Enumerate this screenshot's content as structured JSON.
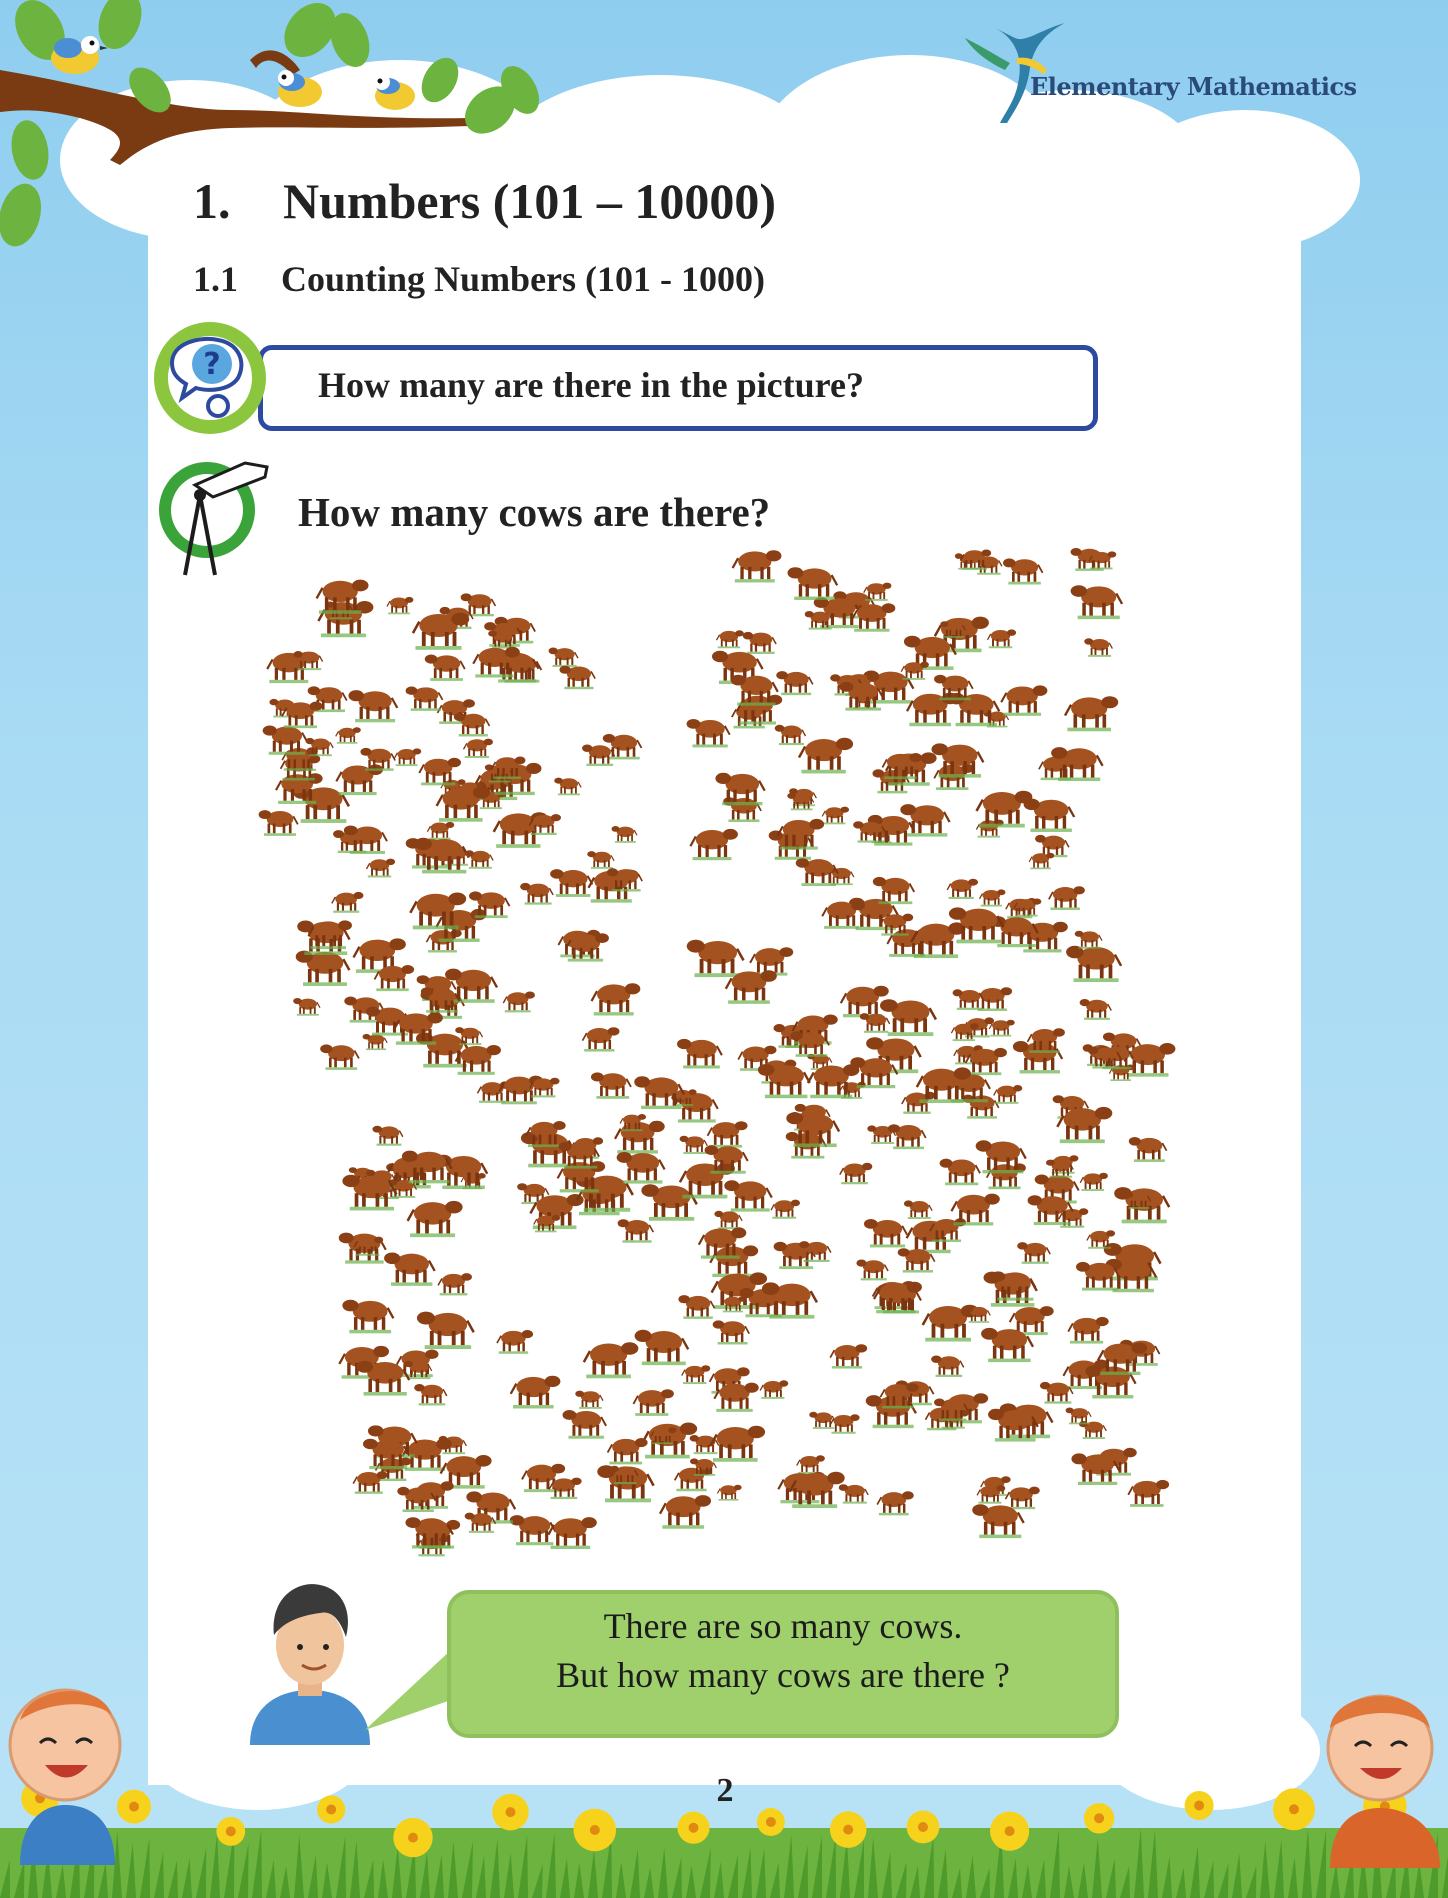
{
  "header": {
    "brand": "Elementary Mathematics",
    "logo_icon": "hummingbird-logo-icon"
  },
  "chapter": {
    "number": "1.",
    "title": "Numbers (101 – 10000)"
  },
  "section": {
    "number": "1.1",
    "title": "Counting Numbers (101 - 1000)"
  },
  "question": {
    "icon": "question-bubble-icon",
    "text": "How many are there in the picture?"
  },
  "activity": {
    "icon": "pencil-compass-icon",
    "text": "How many cows are there?"
  },
  "illustration": {
    "subject": "cow",
    "color": "#a4521f"
  },
  "speech": {
    "line1": "There are so many cows.",
    "line2": "But how many cows are there ?"
  },
  "footer": {
    "page_number": "2"
  },
  "colors": {
    "sky": "#9bd4f0",
    "title_box_border": "#2d4aa0",
    "icon_green": "#8cc63f",
    "speech_bubble": "#9fd06c",
    "cow": "#a4521f"
  }
}
